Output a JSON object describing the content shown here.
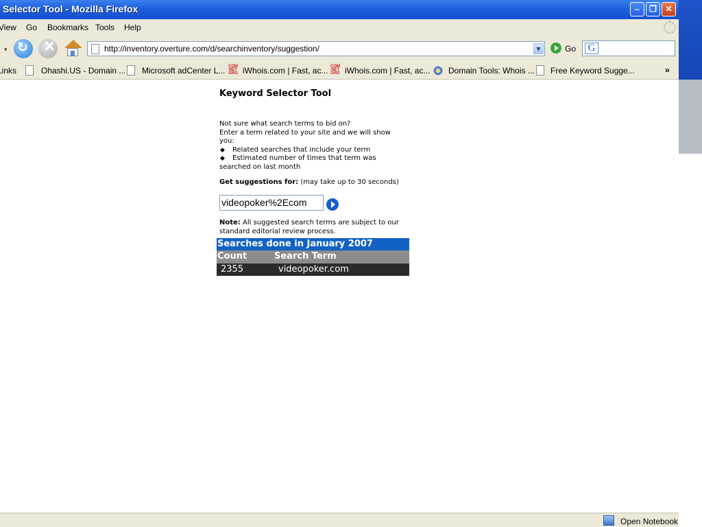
{
  "window": {
    "title": "Selector Tool - Mozilla Firefox",
    "controls": {
      "minimize": "–",
      "maximize": "❐",
      "close": "✕"
    }
  },
  "menu": [
    "View",
    "Go",
    "Bookmarks",
    "Tools",
    "Help"
  ],
  "nav": {
    "url": "http://inventory.overture.com/d/searchinventory/suggestion/",
    "go_label": "Go",
    "search_value": ""
  },
  "bookmarks": {
    "links_label": "Links",
    "items": [
      {
        "label": "Ohashi.US - Domain ...",
        "icon": "page-icon"
      },
      {
        "label": "Microsoft adCenter L...",
        "icon": "page-icon"
      },
      {
        "label": "iWhois.com | Fast, ac...",
        "icon": "com-net-org-icon"
      },
      {
        "label": "iWhois.com | Fast, ac...",
        "icon": "com-net-org-icon"
      },
      {
        "label": "Domain Tools: Whois ...",
        "icon": "gear-icon"
      },
      {
        "label": "Free Keyword Sugge...",
        "icon": "page-icon"
      }
    ],
    "more": "»"
  },
  "tool": {
    "title": "Keyword Selector Tool",
    "intro_line1": "Not sure what search terms to bid on?",
    "intro_line2": "Enter a term related to your site and we will show you:",
    "bullet1": "Related searches that include your term",
    "bullet2": "Estimated number of times that term was searched on last month",
    "suggest_label": "Get suggestions for:",
    "suggest_hint": "(may take up to 30 seconds)",
    "input_value": "videopoker%2Ecom",
    "note_label": "Note:",
    "note_text": "All suggested search terms are subject to our standard editorial review process."
  },
  "results": {
    "heading": "Searches done in January 2007",
    "col_count": "Count",
    "col_term": "Search Term",
    "rows": [
      {
        "count": "2355",
        "term": "videopoker.com"
      }
    ]
  },
  "status": {
    "notebook": "Open Notebook"
  },
  "colors": {
    "titlebar": "#1f5fdc",
    "results_header": "#1162c4",
    "results_columns": "#8c8c8c",
    "results_row": "#2b2b2b"
  }
}
